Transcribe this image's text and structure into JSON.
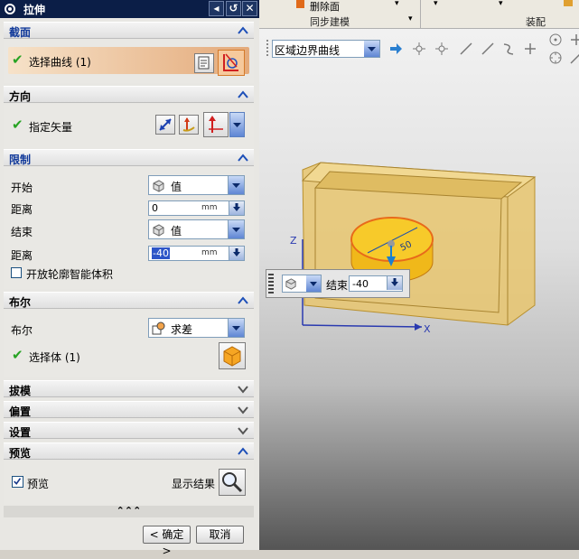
{
  "dialog": {
    "title": "拉伸",
    "sections": {
      "section": {
        "label": "截面",
        "select_curve": "选择曲线 (1)"
      },
      "direction": {
        "label": "方向",
        "specify_vector": "指定矢量"
      },
      "limits": {
        "label": "限制",
        "start_label": "开始",
        "start_option": "值",
        "start_distance_label": "距离",
        "start_distance": "0",
        "end_label": "结束",
        "end_option": "值",
        "end_distance_label": "距离",
        "end_distance": "-40",
        "unit": "mm",
        "open_profile_label": "开放轮廓智能体积"
      },
      "boolean": {
        "label": "布尔",
        "boolean_label": "布尔",
        "boolean_option": "求差",
        "select_body": "选择体 (1)"
      },
      "draft": {
        "label": "拔模"
      },
      "offset": {
        "label": "偏置"
      },
      "settings": {
        "label": "设置"
      },
      "preview": {
        "label": "预览",
        "preview_checkbox": "预览",
        "show_result": "显示结果"
      }
    },
    "ok": "< 确定 >",
    "cancel": "取消"
  },
  "ribbon": {
    "delete_face": "删除面",
    "sync_modeling": "同步建模",
    "assembly": "装配"
  },
  "selection_bar": {
    "filter": "区域边界曲线"
  },
  "float_toolbar": {
    "end_label": "结束",
    "end_value": "-40"
  },
  "viewport": {
    "axis_z": "Z",
    "axis_x": "X",
    "dim_label": "50"
  },
  "colors": {
    "title_bg": "#0b1e47",
    "active_selection": "#e9b98d",
    "model_body": "#e8c66e",
    "cylinder": "#f5c51c"
  }
}
